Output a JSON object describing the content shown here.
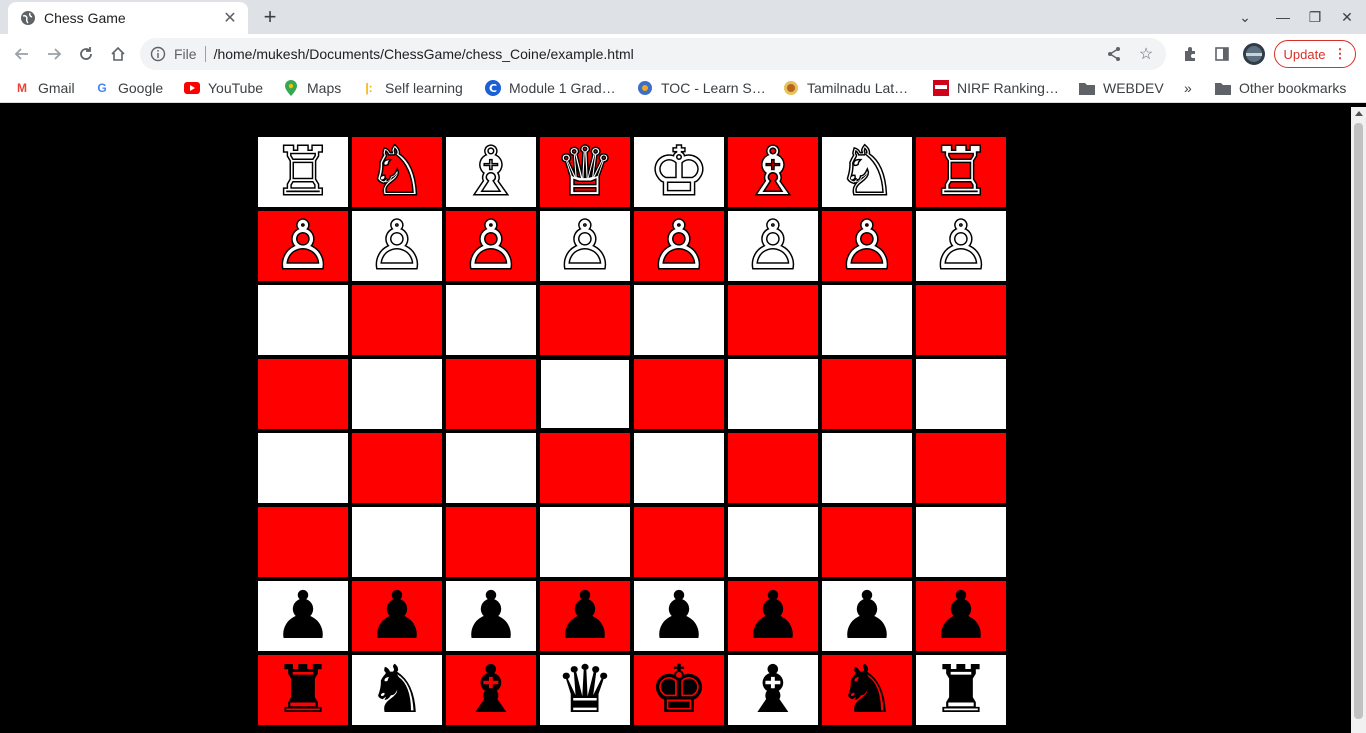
{
  "browser": {
    "tab_title": "Chess Game",
    "url_scheme": "File",
    "url": "/home/mukesh/Documents/ChessGame/chess_Coine/example.html",
    "update_label": "Update",
    "update_color": "#d93025"
  },
  "bookmarks": [
    {
      "label": "Gmail",
      "icon": "gmail-icon"
    },
    {
      "label": "Google",
      "icon": "google-icon"
    },
    {
      "label": "YouTube",
      "icon": "youtube-icon"
    },
    {
      "label": "Maps",
      "icon": "maps-icon"
    },
    {
      "label": "Self learning",
      "icon": "self-learning-icon"
    },
    {
      "label": "Module 1 Grad…",
      "icon": "module-icon"
    },
    {
      "label": "TOC - Learn S…",
      "icon": "toc-icon"
    },
    {
      "label": "Tamilnadu Lat…",
      "icon": "tamilnadu-icon"
    },
    {
      "label": "NIRF Ranking…",
      "icon": "nirf-icon"
    },
    {
      "label": "WEBDEV",
      "icon": "folder-icon"
    }
  ],
  "bookmarks_overflow": "»",
  "other_bookmarks": "Other bookmarks",
  "board": {
    "light_color": "#ffffff",
    "dark_color": "#ff0000",
    "selected_square": "d5",
    "rows": [
      [
        "♖",
        "♘",
        "♗",
        "♕",
        "♔",
        "♗",
        "♘",
        "♖"
      ],
      [
        "♙",
        "♙",
        "♙",
        "♙",
        "♙",
        "♙",
        "♙",
        "♙"
      ],
      [
        "",
        "",
        "",
        "",
        "",
        "",
        "",
        ""
      ],
      [
        "",
        "",
        "",
        "",
        "",
        "",
        "",
        ""
      ],
      [
        "",
        "",
        "",
        "",
        "",
        "",
        "",
        ""
      ],
      [
        "",
        "",
        "",
        "",
        "",
        "",
        "",
        ""
      ],
      [
        "♟",
        "♟",
        "♟",
        "♟",
        "♟",
        "♟",
        "♟",
        "♟"
      ],
      [
        "♜",
        "♞",
        "♝",
        "♛",
        "♚",
        "♝",
        "♞",
        "♜"
      ]
    ]
  }
}
